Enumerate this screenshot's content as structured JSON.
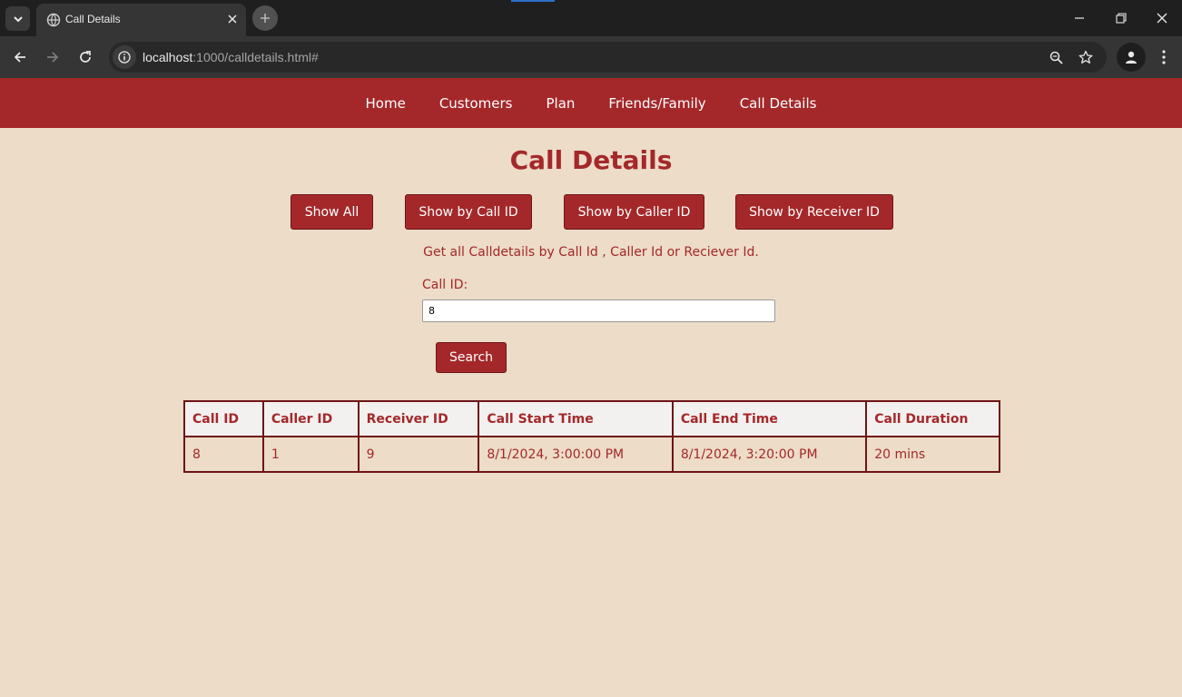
{
  "browser": {
    "tab_title": "Call Details",
    "url_host": "localhost",
    "url_rest": ":1000/calldetails.html#"
  },
  "nav": {
    "items": [
      "Home",
      "Customers",
      "Plan",
      "Friends/Family",
      "Call Details"
    ]
  },
  "page": {
    "title": "Call Details",
    "buttons": {
      "show_all": "Show All",
      "show_by_call_id": "Show by Call ID",
      "show_by_caller_id": "Show by Caller ID",
      "show_by_receiver_id": "Show by Receiver ID"
    },
    "description": "Get all Calldetails by Call Id , Caller Id or Reciever Id.",
    "call_id_label": "Call ID:",
    "call_id_value": "8",
    "search_label": "Search"
  },
  "table": {
    "headers": [
      "Call ID",
      "Caller ID",
      "Receiver ID",
      "Call Start Time",
      "Call End Time",
      "Call Duration"
    ],
    "rows": [
      [
        "8",
        "1",
        "9",
        "8/1/2024, 3:00:00 PM",
        "8/1/2024, 3:20:00 PM",
        "20 mins"
      ]
    ]
  },
  "colors": {
    "brand": "#a4282a",
    "page_bg": "#ecdcc8",
    "header_bg": "#f3f1ef",
    "border": "#6e1416"
  }
}
